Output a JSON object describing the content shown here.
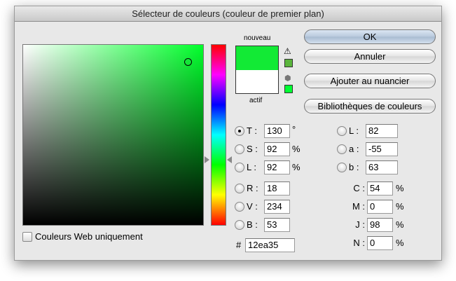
{
  "title": "Sélecteur de couleurs (couleur de premier plan)",
  "buttons": {
    "ok": "OK",
    "cancel": "Annuler",
    "add_swatch": "Ajouter au nuancier",
    "libraries": "Bibliothèques de couleurs"
  },
  "preview": {
    "new_label": "nouveau",
    "current_label": "actif",
    "new_color": "#12ea35",
    "current_color": "#ffffff",
    "gamut_color": "#5ab53c",
    "web_safe_color": "#00ff33"
  },
  "hsb": [
    {
      "label": "T :",
      "value": "130",
      "unit": "°",
      "selected": true
    },
    {
      "label": "S :",
      "value": "92",
      "unit": "%"
    },
    {
      "label": "L :",
      "value": "92",
      "unit": "%"
    }
  ],
  "rgb": [
    {
      "label": "R :",
      "value": "18"
    },
    {
      "label": "V :",
      "value": "234"
    },
    {
      "label": "B :",
      "value": "53"
    }
  ],
  "lab": [
    {
      "label": "L :",
      "value": "82"
    },
    {
      "label": "a :",
      "value": "-55"
    },
    {
      "label": "b :",
      "value": "63"
    }
  ],
  "cmyk": [
    {
      "label": "C :",
      "value": "54",
      "unit": "%"
    },
    {
      "label": "M :",
      "value": "0",
      "unit": "%"
    },
    {
      "label": "J :",
      "value": "98",
      "unit": "%"
    },
    {
      "label": "N :",
      "value": "0",
      "unit": "%"
    }
  ],
  "hex": {
    "label": "#",
    "value": "12ea35"
  },
  "web_only": {
    "label": "Couleurs Web uniquement",
    "checked": false
  },
  "hue_degrees": 130
}
